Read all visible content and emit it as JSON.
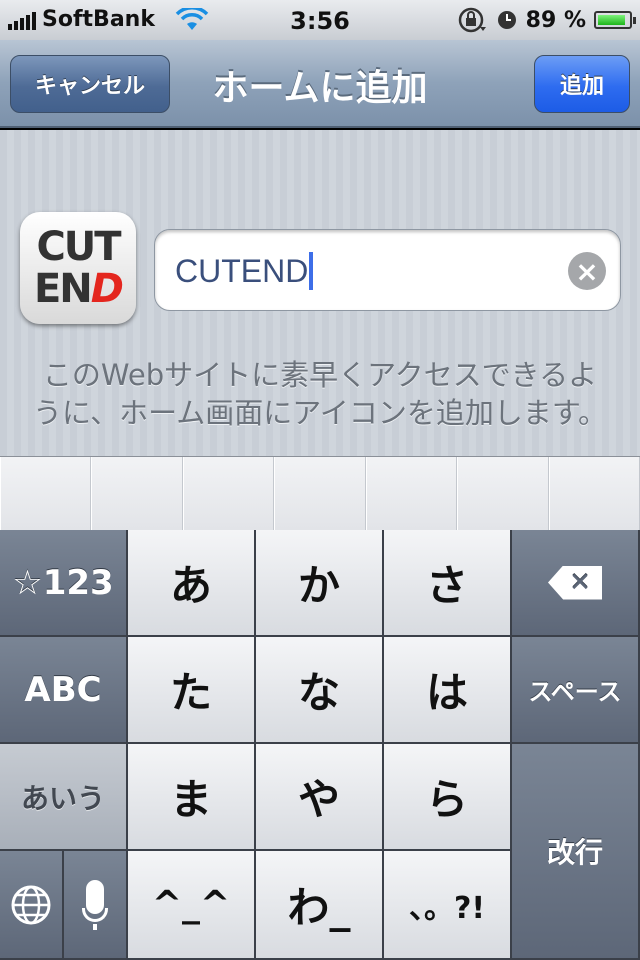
{
  "status_bar": {
    "carrier": "SoftBank",
    "time": "3:56",
    "battery": "89 %",
    "battery_level": 0.89,
    "icons": [
      "signal-bars-icon",
      "wifi-icon",
      "rotation-lock-icon",
      "alarm-clock-icon",
      "battery-icon"
    ]
  },
  "nav": {
    "title": "ホームに追加",
    "cancel_label": "キャンセル",
    "add_label": "追加"
  },
  "app_icon": {
    "line1": "CUT",
    "line2_a": "EN",
    "line2_b": "D"
  },
  "name_field": {
    "value": "CUTEND",
    "clear_icon": "×"
  },
  "description": "このWebサイトに素早くアクセスできるように、ホーム画面にアイコンを追加します。",
  "keyboard": {
    "mode_num": "☆123",
    "mode_abc": "ABC",
    "mode_kana": "あいう",
    "row1": [
      "あ",
      "か",
      "さ"
    ],
    "row2": [
      "た",
      "な",
      "は"
    ],
    "row3": [
      "ま",
      "や",
      "ら"
    ],
    "row4": [
      "^_^",
      "わ_",
      "、。?!"
    ],
    "space": "スペース",
    "return": "改行",
    "backspace_mark": "✕"
  },
  "colors": {
    "nav_gradient_top": "#b8c5d4",
    "add_button": "#2e6cf0",
    "caret": "#3d6ee8"
  }
}
